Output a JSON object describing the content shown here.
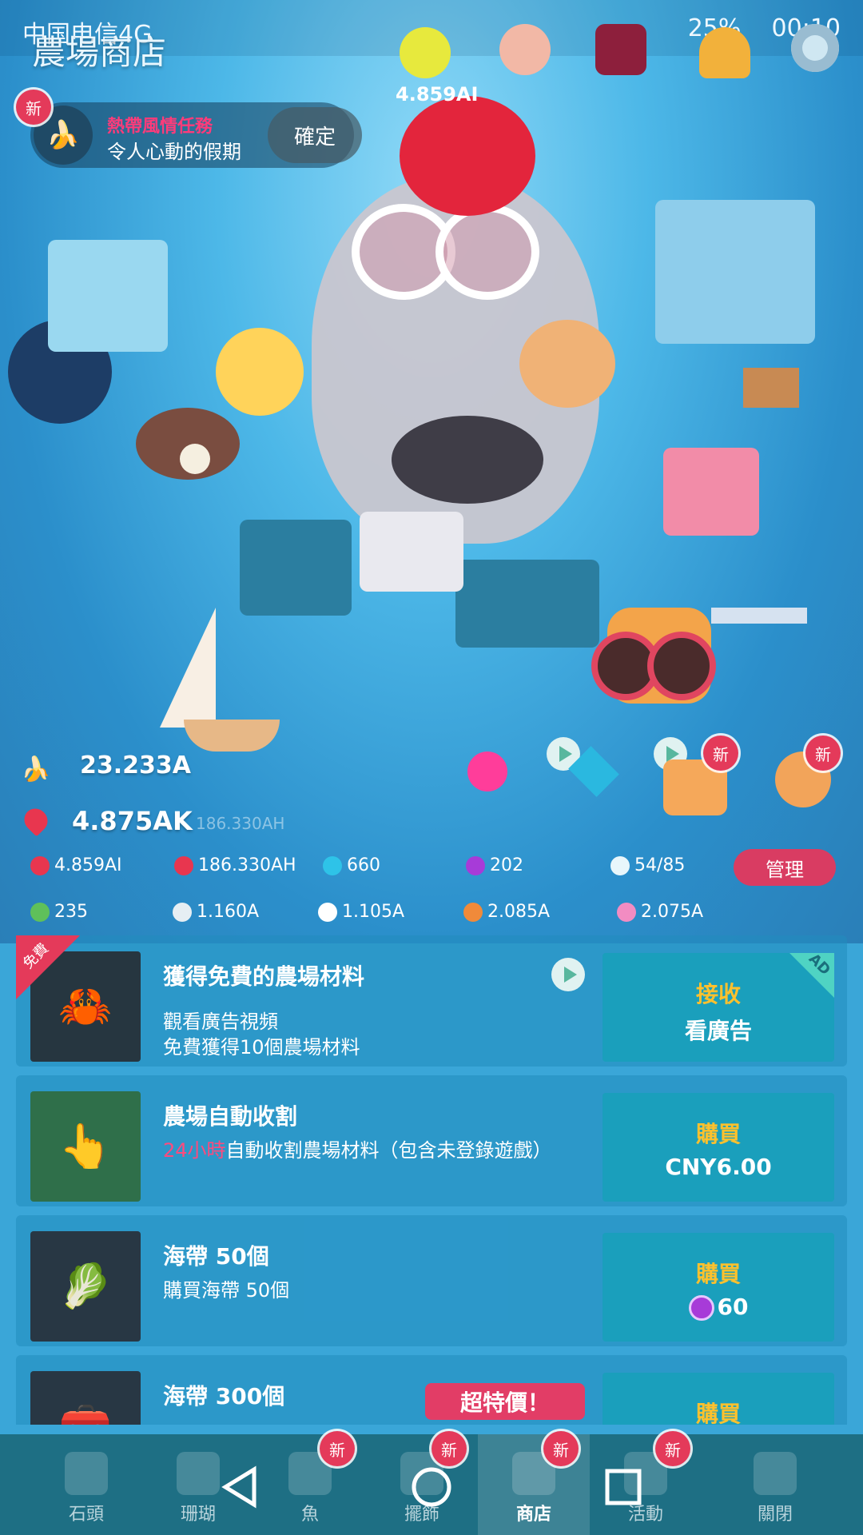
{
  "status_bar": {
    "carrier": "中国电信4G",
    "battery": "25%",
    "time": "00:10"
  },
  "header": {
    "title": "農場商店",
    "floating_values": [
      "4.859AI",
      "4.859AI"
    ]
  },
  "quest": {
    "badge": "新",
    "title": "熱帶風情任務",
    "subtitle": "令人心動的假期",
    "confirm": "確定"
  },
  "scene_badges": {
    "new_a": "新",
    "new_b": "新"
  },
  "resources": {
    "bananas": "23.233A",
    "hearts": "4.875AK",
    "hearts_rate": "186.330AH",
    "row1": [
      {
        "icon": "heart-icon",
        "value": "4.859AI"
      },
      {
        "icon": "heart-clock-icon",
        "value": "186.330AH"
      },
      {
        "icon": "diamond-icon",
        "value": "660"
      },
      {
        "icon": "gem-icon",
        "value": "202"
      },
      {
        "icon": "fish-icon",
        "value": "54/85"
      }
    ],
    "manage": "管理",
    "row2": [
      {
        "icon": "seaweed-icon",
        "value": "235"
      },
      {
        "icon": "shell-icon",
        "value": "1.160A"
      },
      {
        "icon": "urchin-icon",
        "value": "1.105A"
      },
      {
        "icon": "crab-icon",
        "value": "2.085A"
      },
      {
        "icon": "seahorse-icon",
        "value": "2.075A"
      }
    ]
  },
  "shop": {
    "items": [
      {
        "tag": "免費",
        "name": "獲得免費的農場材料",
        "desc1": "觀看廣告視頻",
        "desc2": "免費獲得10個農場材料",
        "btn_top": "接收",
        "btn_bottom": "看廣告",
        "ad": "AD"
      },
      {
        "name": "農場自動收割",
        "desc_highlight": "24小時",
        "desc_rest": "自動收割農場材料（包含未登錄遊戲）",
        "btn_top": "購買",
        "btn_bottom": "CNY6.00"
      },
      {
        "name": "海帶 50個",
        "desc1": "購買海帶 50個",
        "btn_top": "購買",
        "btn_bottom": "60"
      },
      {
        "name": "海帶 300個",
        "special": "超特價！",
        "btn_top": "購買"
      }
    ]
  },
  "bottom_nav": {
    "tabs": [
      {
        "label": "石頭",
        "badge": ""
      },
      {
        "label": "珊瑚",
        "badge": ""
      },
      {
        "label": "魚",
        "badge": "新"
      },
      {
        "label": "擺飾",
        "badge": "新"
      },
      {
        "label": "商店",
        "badge": "新"
      },
      {
        "label": "活動",
        "badge": "新"
      },
      {
        "label": "關閉",
        "badge": ""
      }
    ]
  },
  "colors": {
    "accent_pink": "#e43a5a",
    "button_teal": "#1a9fbc",
    "price_gold": "#ffc12d"
  }
}
